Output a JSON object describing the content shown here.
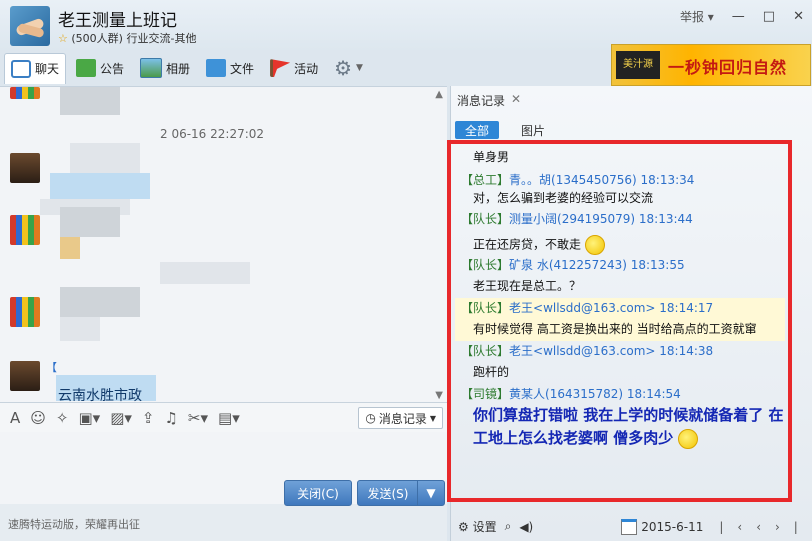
{
  "window": {
    "title": "老王测量上班记",
    "subtitle_count": "(500人群)",
    "subtitle_category": "行业交流-其他",
    "report": "举报"
  },
  "tabs": [
    {
      "label": "聊天",
      "icon": "chat-icon"
    },
    {
      "label": "公告",
      "icon": "notice-icon"
    },
    {
      "label": "相册",
      "icon": "album-icon"
    },
    {
      "label": "文件",
      "icon": "file-icon"
    },
    {
      "label": "活动",
      "icon": "flag-icon"
    }
  ],
  "ad": {
    "brand": "美汁源",
    "slogan": "一秒钟回归自然"
  },
  "chat": {
    "timestamp_fragment": "2   06-16 22:27:02",
    "partial_text_1": "云南水胜市政",
    "partial_text_2": "【"
  },
  "input_toolbar": {
    "history_label": "消息记录"
  },
  "footer": {
    "ad_text": "速腾特运动版，荣耀再出征",
    "close_label": "关闭(C)",
    "send_label": "发送(S)"
  },
  "history_panel": {
    "tab_title": "消息记录",
    "subtab_all": "全部",
    "subtab_pics": "图片",
    "records": [
      {
        "body": "单身男"
      },
      {
        "role": "【总工】",
        "nick": "青。。胡(1345450756) 18:13:34",
        "body": "对，怎么骗到老婆的经验可以交流"
      },
      {
        "role": "【队长】",
        "nick": "测量小阔(294195079) 18:13:44",
        "body": "正在还房贷，不敢走"
      },
      {
        "role": "【队长】",
        "nick": "矿泉 水(412257243) 18:13:55",
        "body": "老王现在是总工。？"
      },
      {
        "role": "【队长】",
        "nick": "老王<wllsdd@163.com> 18:14:17",
        "body": "有时候觉得 高工资是换出来的  当时给高点的工资就窜"
      },
      {
        "role": "【队长】",
        "nick": "老王<wllsdd@163.com> 18:14:38",
        "body": "跑杆的"
      },
      {
        "role": "【司镜】",
        "nick": "黄某人(164315782) 18:14:54",
        "body": "你们算盘打错啦 我在上学的时候就储备着了 在工地上怎么找老婆啊 僧多肉少"
      }
    ],
    "settings_label": "设置",
    "date": "2015-6-11"
  }
}
